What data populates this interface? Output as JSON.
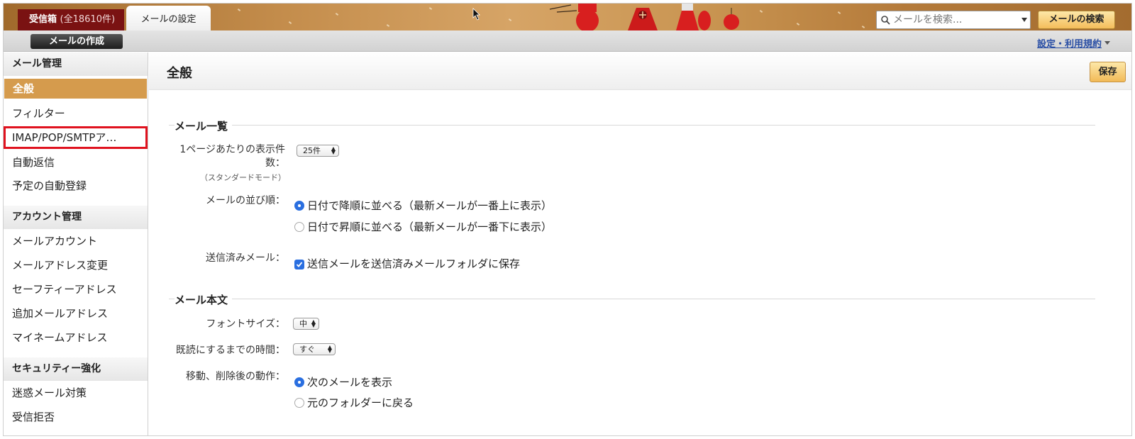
{
  "header": {
    "tab_inbox": "受信箱",
    "tab_inbox_count": "(全18610件)",
    "tab_settings": "メールの設定",
    "search_placeholder": "メールを検索...",
    "search_button": "メールの検索"
  },
  "toolbar": {
    "compose_button": "メールの作成",
    "settings_link": "設定・利用規約"
  },
  "sidebar": {
    "sections": [
      {
        "title": "メール管理",
        "items": [
          "全般",
          "フィルター",
          "IMAP/POP/SMTPア…",
          "自動返信",
          "予定の自動登録"
        ]
      },
      {
        "title": "アカウント管理",
        "items": [
          "メールアカウント",
          "メールアドレス変更",
          "セーフティーアドレス",
          "追加メールアドレス",
          "マイネームアドレス"
        ]
      },
      {
        "title": "セキュリティー強化",
        "items": [
          "迷惑メール対策",
          "受信拒否"
        ]
      }
    ],
    "active_item": "全般",
    "highlight_color": "#e0121e",
    "active_color": "#d59b4d"
  },
  "main": {
    "page_title": "全般",
    "save_button": "保存",
    "mail_list": {
      "title": "メール一覧",
      "per_page_label_1": "1ページあたりの表示件",
      "per_page_label_2": "数：",
      "per_page_sublabel": "（スタンダードモード）",
      "per_page_value": "25件",
      "sort_label": "メールの並び順：",
      "sort_options": [
        "日付で降順に並べる（最新メールが一番上に表示）",
        "日付で昇順に並べる（最新メールが一番下に表示）"
      ],
      "sort_selected": 0,
      "sent_label": "送信済みメール：",
      "sent_checkbox": "送信メールを送信済みメールフォルダに保存",
      "sent_checked": true
    },
    "mail_body": {
      "title": "メール本文",
      "font_size_label": "フォントサイズ：",
      "font_size_value": "中",
      "read_time_label": "既読にするまでの時間：",
      "read_time_value": "すぐ",
      "after_move_label": "移動、削除後の動作：",
      "after_move_options": [
        "次のメールを表示",
        "元のフォルダーに戻る"
      ],
      "after_move_selected": 0
    }
  }
}
